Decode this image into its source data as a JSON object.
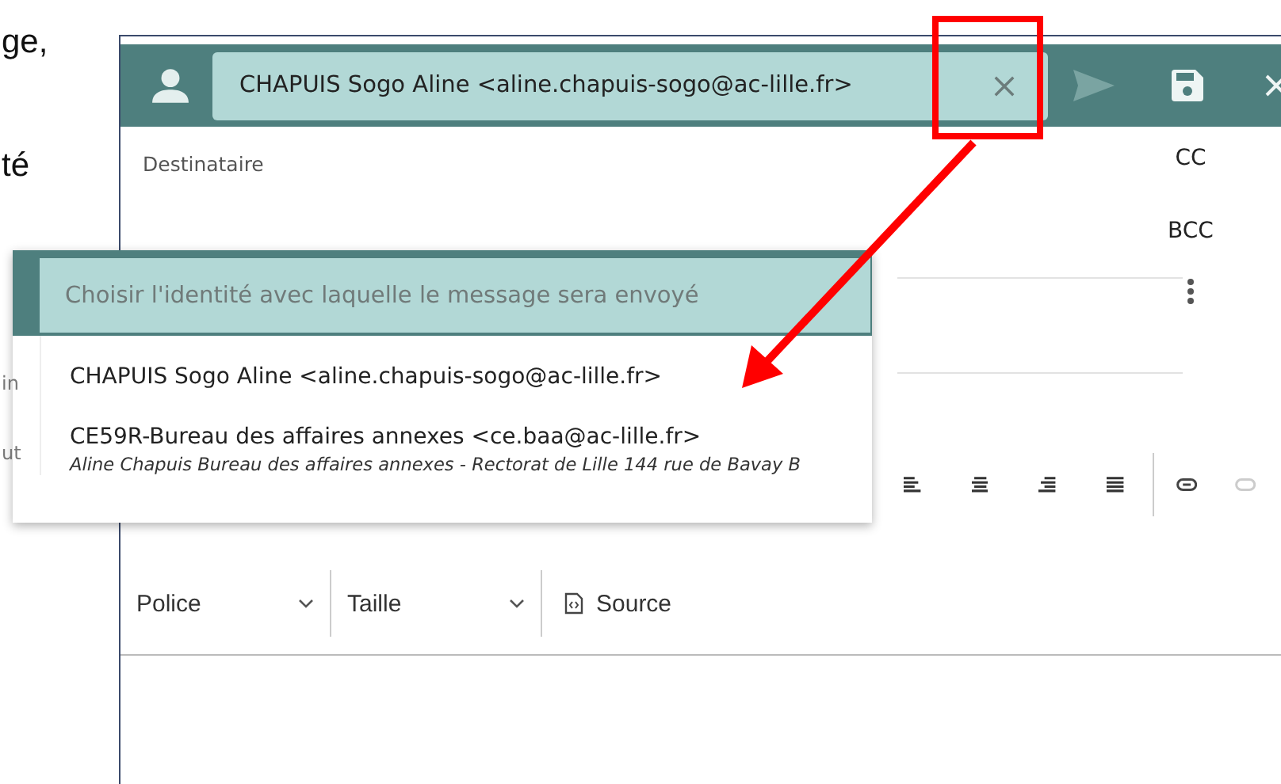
{
  "doc_text": [
    "ge,",
    "té"
  ],
  "behind_text": [
    "in",
    "ut"
  ],
  "composer": {
    "identity": "CHAPUIS Sogo Aline <aline.chapuis-sogo@ac-lille.fr>",
    "recipient_label": "Destinataire",
    "side_actions": [
      "CC",
      "BCC"
    ],
    "toolbar": {
      "font_label": "Police",
      "size_label": "Taille",
      "source_label": "Source"
    }
  },
  "identity_menu": {
    "placeholder": "Choisir l'identité avec laquelle le message sera envoyé",
    "options": [
      {
        "label": "CHAPUIS Sogo Aline <aline.chapuis-sogo@ac-lille.fr>"
      },
      {
        "label": "CE59R-Bureau des affaires annexes <ce.baa@ac-lille.fr>",
        "detail": "Aline Chapuis Bureau des affaires annexes - Rectorat de Lille 144 rue de Bavay B"
      }
    ]
  }
}
